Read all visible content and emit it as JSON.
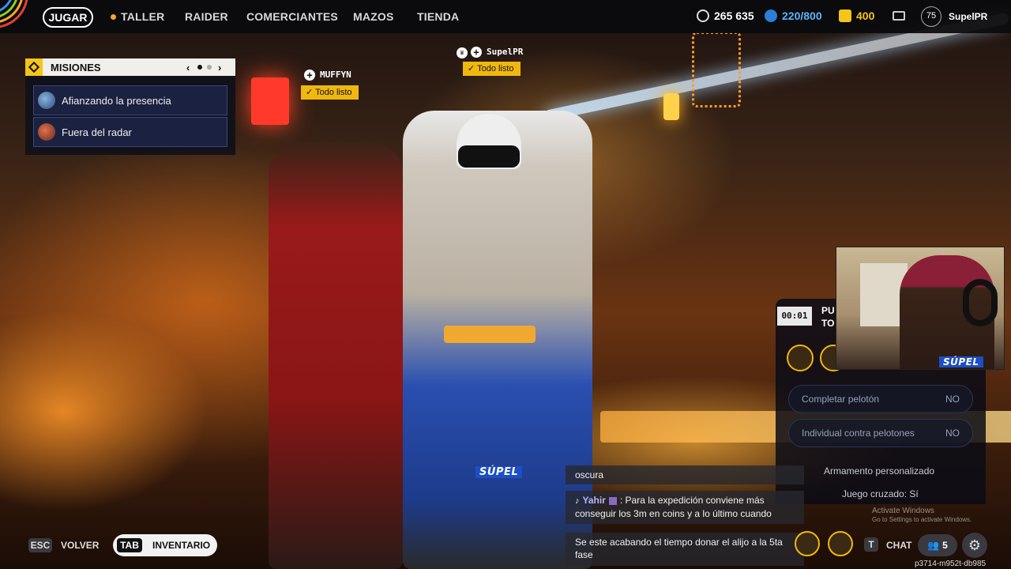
{
  "nav": {
    "play": "JUGAR",
    "items": [
      {
        "label": "TALLER"
      },
      {
        "label": "RAIDER"
      },
      {
        "label": "COMERCIANTES"
      },
      {
        "label": "MAZOS"
      },
      {
        "label": "TIENDA"
      }
    ]
  },
  "currencies": {
    "coins": "265 635",
    "raider_tokens": "220/800",
    "cred": "400"
  },
  "profile": {
    "level": "75",
    "name": "SupelPR"
  },
  "missions": {
    "title": "MISIONES",
    "items": [
      {
        "label": "Afianzando la presencia"
      },
      {
        "label": "Fuera del radar"
      }
    ]
  },
  "party": {
    "player1": {
      "name": "MUFFYN",
      "status": "Todo listo"
    },
    "player2": {
      "name": "SupelPR",
      "status": "Todo listo"
    }
  },
  "match_panel": {
    "timer": "00:01",
    "header_partial_1": "PU",
    "header_partial_2": "TO",
    "options": [
      {
        "label": "Completar pelotón",
        "value": "NO"
      },
      {
        "label": "Individual contra pelotones",
        "value": "NO"
      }
    ],
    "custom_loadout": "Armamento personalizado",
    "crossplay": "Juego cruzado: Sí",
    "watermark_title": "Activate Windows",
    "watermark_sub": "Go to Settings to activate Windows."
  },
  "chat": {
    "messages": [
      {
        "text": "oscura"
      },
      {
        "user": "Yahir",
        "text": ": Para la expedición conviene más conseguir los 3m en coins y a lo último cuando"
      },
      {
        "text": "Se este acabando el tiempo donar el alijo a la 5ta fase"
      }
    ]
  },
  "stream_overlay": {
    "brand": "SÚPEL"
  },
  "bottom_bar": {
    "esc_key": "ESC",
    "back": "VOLVER",
    "tab_key": "TAB",
    "inventory": "INVENTARIO",
    "chat_key": "T",
    "chat": "CHAT",
    "friends_count": "5",
    "lobby_id": "p3714-m952t-db985"
  },
  "colors": {
    "accent_yellow": "#f0b70f",
    "panel_dark": "#0e101a",
    "mission_blue": "#1b2140"
  }
}
